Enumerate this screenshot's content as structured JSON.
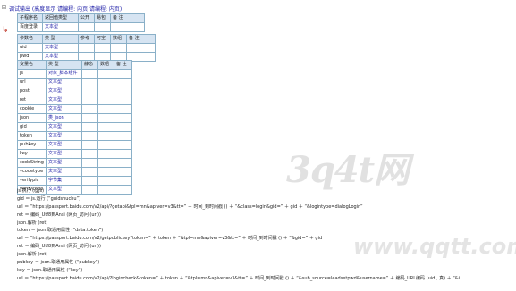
{
  "header": {
    "collapse": "⊟",
    "text": "调试输出 (高度显示 请编程: 内页 请编程: 内页)"
  },
  "gutter_mark": "↳",
  "table1": {
    "headers": [
      "子程序名",
      "返回值类型",
      "公开",
      "易包",
      "备 注"
    ],
    "rows": [
      [
        "百度登录",
        "文本型",
        "",
        "",
        ""
      ]
    ]
  },
  "table2": {
    "headers": [
      "参数名",
      "类 型",
      "参考",
      "可空",
      "数组",
      "备 注"
    ],
    "rows": [
      [
        "uid",
        "文本型",
        "",
        "",
        "",
        ""
      ],
      [
        "pwd",
        "文本型",
        "",
        "",
        "",
        ""
      ]
    ]
  },
  "table3": {
    "headers": [
      "变量名",
      "类 型",
      "静态",
      "数组",
      "备 注"
    ],
    "rows": [
      [
        "js",
        "对象_脚本组件",
        "",
        "",
        ""
      ],
      [
        "url",
        "文本型",
        "",
        "",
        ""
      ],
      [
        "post",
        "文本型",
        "",
        "",
        ""
      ],
      [
        "ret",
        "文本型",
        "",
        "",
        ""
      ],
      [
        "cookie",
        "文本型",
        "",
        "",
        ""
      ],
      [
        "json",
        "类_json",
        "",
        "",
        ""
      ],
      [
        "gid",
        "文本型",
        "",
        "",
        ""
      ],
      [
        "token",
        "文本型",
        "",
        "",
        ""
      ],
      [
        "pubkey",
        "文本型",
        "",
        "",
        ""
      ],
      [
        "key",
        "文本型",
        "",
        "",
        ""
      ],
      [
        "codeString",
        "文本型",
        "",
        "",
        ""
      ],
      [
        "vcodetype",
        "文本型",
        "",
        "",
        ""
      ],
      [
        "verifypic",
        "字节集",
        "",
        "",
        ""
      ],
      [
        "verifycode",
        "文本型",
        "",
        "",
        ""
      ]
    ]
  },
  "code_lines": [
    "js.执行 (@js)",
    "gid ＝ js.运行 (“guidshuchu”)",
    "url ＝ “https://passport.baidu.com/v2/api/?getapi&tpl=mn&apiver=v3&tt=” ＋ 时间_到时间戳 () ＋ “&class=login&gid=” ＋ gid ＋ “&logintype=dialogLogin”",
    "ret ＝ 编码_Utf8到Ansi (网页_访问 (url))",
    "json.解析 (ret)",
    "token ＝ json.取通用属性 (“data.token”)",
    "url ＝ “https://passport.baidu.com/v2/getpublickey?token=” ＋ token ＋ “&tpl=mn&apiver=v3&tt=” ＋ 时间_到时间戳 () ＋ “&gid=” ＋ gid",
    "ret ＝ 编码_Utf8到Ansi (网页_访问 (url))",
    "json.解析 (ret)",
    "pubkey ＝ json.取通用属性 (“pubkey”)",
    "key ＝ json.取通用属性 (“key”)",
    "url ＝ “https://passport.baidu.com/v2/api/?logincheck&token=” ＋ token ＋ “&tpl=mn&apiver=v3&tt=” ＋ 时间_到时间戳 () ＋ “&sub_source=leadsetpwd&username=” ＋ 编码_URL编码 (uid , 真) ＋ “&i"
  ],
  "watermark": {
    "large": "3q4t网",
    "small": "www.qqtt.com"
  }
}
